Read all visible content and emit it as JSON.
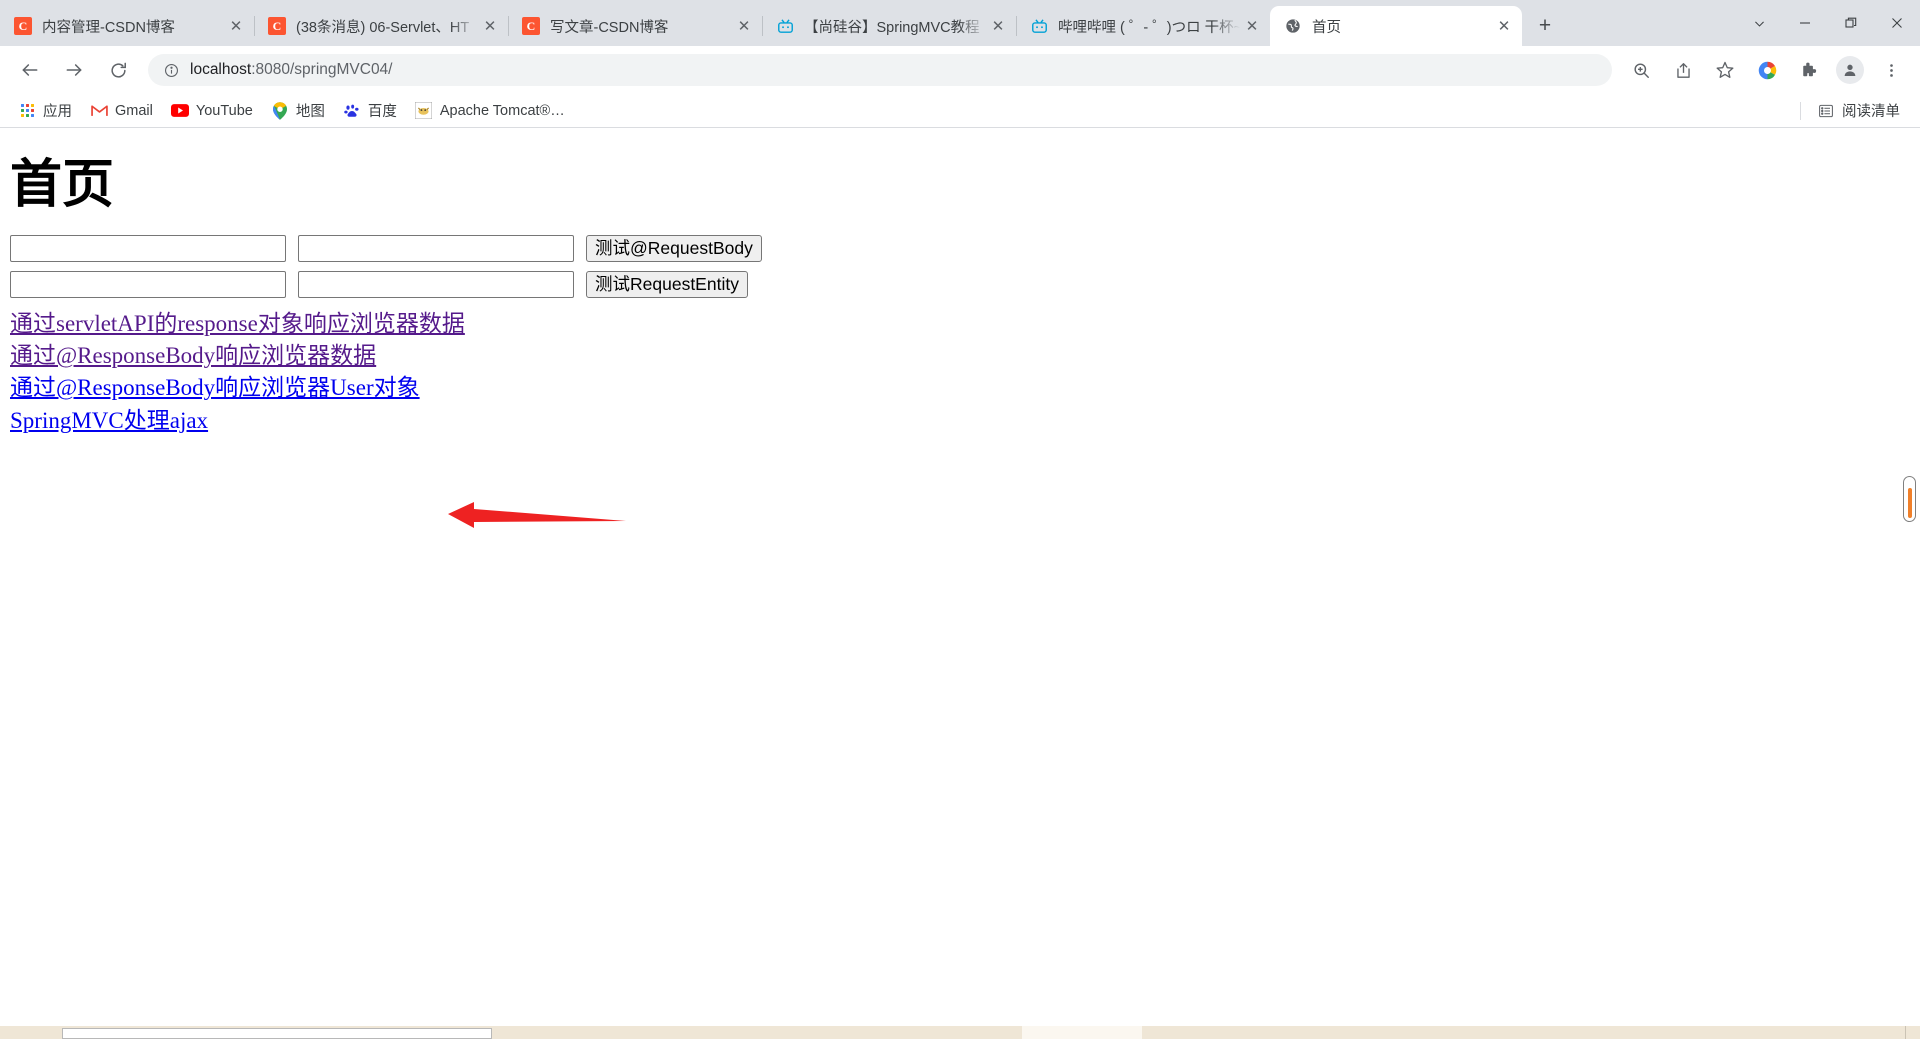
{
  "window": {
    "controls": {
      "tablist_chevron": "chevron-down",
      "minimize": "—",
      "restore": "❐",
      "close": "✕"
    }
  },
  "tabstrip": {
    "new_tab_label": "+",
    "tabs": [
      {
        "title": "内容管理-CSDN博客",
        "favicon": "csdn-icon",
        "favicon_text": "C",
        "active": false,
        "close": "✕"
      },
      {
        "title": "(38条消息) 06-Servlet、HT",
        "favicon": "csdn-icon",
        "favicon_text": "C",
        "active": false,
        "close": "✕"
      },
      {
        "title": "写文章-CSDN博客",
        "favicon": "csdn-icon",
        "favicon_text": "C",
        "active": false,
        "close": "✕"
      },
      {
        "title": "【尚硅谷】SpringMVC教程",
        "favicon": "bilibili-icon",
        "favicon_text": "📺",
        "active": false,
        "close": "✕"
      },
      {
        "title": "哔哩哔哩 ( ゜- ゜)つロ 干杯~",
        "favicon": "bilibili-icon",
        "favicon_text": "📺",
        "active": false,
        "close": "✕"
      },
      {
        "title": "首页",
        "favicon": "globe-icon",
        "favicon_text": "🌐",
        "active": true,
        "close": "✕"
      }
    ]
  },
  "toolbar": {
    "back_label": "←",
    "forward_label": "→",
    "reload_label": "⟳",
    "info_icon": "ⓘ",
    "url_host": "localhost",
    "url_rest": ":8080/springMVC04/",
    "url_full": "localhost:8080/springMVC04/",
    "actions": [
      {
        "name": "zoom-icon",
        "glyph": "⌕"
      },
      {
        "name": "share-icon",
        "glyph": "↗"
      },
      {
        "name": "bookmark-star-icon",
        "glyph": "☆"
      },
      {
        "name": "google-account-icon",
        "glyph": "◉"
      },
      {
        "name": "extensions-puzzle-icon",
        "glyph": "🧩"
      },
      {
        "name": "profile-avatar-icon",
        "glyph": "👤"
      },
      {
        "name": "chrome-menu-icon",
        "glyph": "⋮"
      }
    ]
  },
  "bookmarks": {
    "items": [
      {
        "label": "应用",
        "icon": "apps-grid-icon"
      },
      {
        "label": "Gmail",
        "icon": "gmail-icon"
      },
      {
        "label": "YouTube",
        "icon": "youtube-icon"
      },
      {
        "label": "地图",
        "icon": "maps-pin-icon"
      },
      {
        "label": "百度",
        "icon": "baidu-icon"
      },
      {
        "label": "Apache Tomcat®…",
        "icon": "tomcat-icon"
      }
    ],
    "reading_list": {
      "label": "阅读清单",
      "icon": "reading-list-icon"
    }
  },
  "page": {
    "heading": "首页",
    "form": {
      "row1": {
        "field1_value": "",
        "field2_value": "",
        "button_label": "测试@RequestBody"
      },
      "row2": {
        "field1_value": "",
        "field2_value": "",
        "button_label": "测试RequestEntity"
      }
    },
    "links": [
      {
        "text": "通过servletAPI的response对象响应浏览器数据",
        "state": "visited"
      },
      {
        "text": "通过@ResponseBody响应浏览器数据",
        "state": "visited"
      },
      {
        "text": "通过@ResponseBody响应浏览器User对象",
        "state": "unvisited"
      },
      {
        "text": "SpringMVC处理ajax",
        "state": "unvisited"
      }
    ],
    "annotation": {
      "type": "red-arrow",
      "points_to": "通过@ResponseBody响应浏览器数据",
      "color": "#ee2222"
    }
  },
  "taskbar": {
    "clock": ""
  },
  "colors": {
    "tabstrip_bg": "#dee1e6",
    "active_tab_bg": "#ffffff",
    "omnibox_bg": "#f1f3f4",
    "link_visited": "#551a8b",
    "link_unvisited": "#0000ee",
    "annotation_red": "#ee2222",
    "scroll_marker_orange": "#f0802a",
    "taskbar_bg": "#efe6d6"
  }
}
